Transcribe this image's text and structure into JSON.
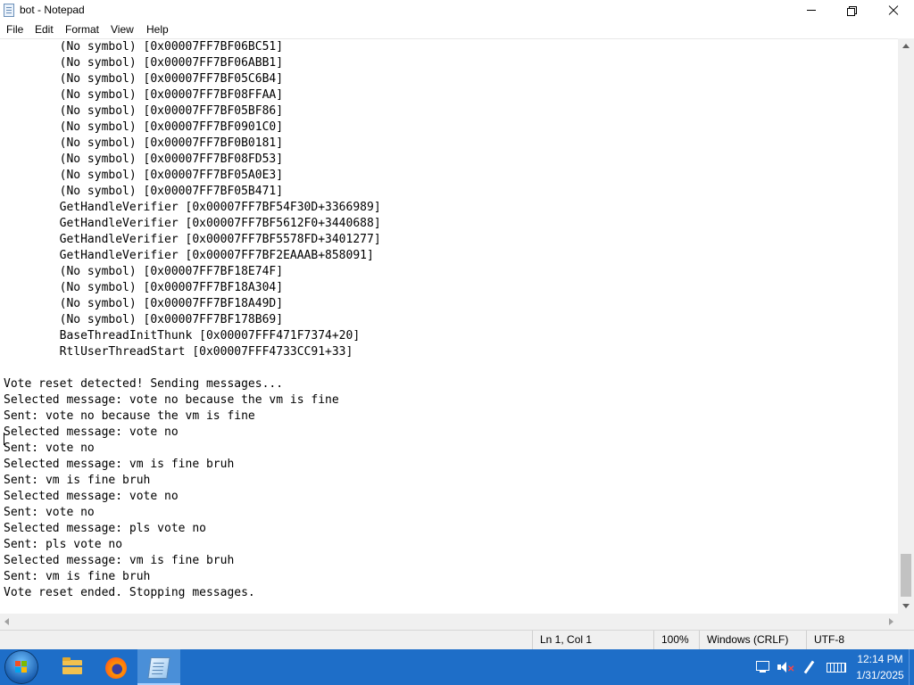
{
  "window": {
    "title": "bot - Notepad",
    "controls": {
      "minimize": "minimize",
      "maximize": "restore",
      "close": "close"
    }
  },
  "menu": {
    "items": [
      "File",
      "Edit",
      "Format",
      "View",
      "Help"
    ]
  },
  "editor": {
    "lines": [
      "        (No symbol) [0x00007FF7BF06BC51]",
      "        (No symbol) [0x00007FF7BF06ABB1]",
      "        (No symbol) [0x00007FF7BF05C6B4]",
      "        (No symbol) [0x00007FF7BF08FFAA]",
      "        (No symbol) [0x00007FF7BF05BF86]",
      "        (No symbol) [0x00007FF7BF0901C0]",
      "        (No symbol) [0x00007FF7BF0B0181]",
      "        (No symbol) [0x00007FF7BF08FD53]",
      "        (No symbol) [0x00007FF7BF05A0E3]",
      "        (No symbol) [0x00007FF7BF05B471]",
      "        GetHandleVerifier [0x00007FF7BF54F30D+3366989]",
      "        GetHandleVerifier [0x00007FF7BF5612F0+3440688]",
      "        GetHandleVerifier [0x00007FF7BF5578FD+3401277]",
      "        GetHandleVerifier [0x00007FF7BF2EAAAB+858091]",
      "        (No symbol) [0x00007FF7BF18E74F]",
      "        (No symbol) [0x00007FF7BF18A304]",
      "        (No symbol) [0x00007FF7BF18A49D]",
      "        (No symbol) [0x00007FF7BF178B69]",
      "        BaseThreadInitThunk [0x00007FFF471F7374+20]",
      "        RtlUserThreadStart [0x00007FFF4733CC91+33]",
      "",
      "Vote reset detected! Sending messages...",
      "Selected message: vote no because the vm is fine",
      "Sent: vote no because the vm is fine",
      "Selected message: vote no",
      "Sent: vote no",
      "Selected message: vm is fine bruh",
      "Sent: vm is fine bruh",
      "Selected message: vote no",
      "Sent: vote no",
      "Selected message: pls vote no",
      "Sent: pls vote no",
      "Selected message: vm is fine bruh",
      "Sent: vm is fine bruh",
      "Vote reset ended. Stopping messages."
    ]
  },
  "status": {
    "position": "Ln 1, Col 1",
    "zoom": "100%",
    "line_endings": "Windows (CRLF)",
    "encoding": "UTF-8"
  },
  "taskbar": {
    "apps": [
      "file-explorer",
      "firefox",
      "notepad"
    ],
    "active_app": "notepad",
    "tray_icons": [
      "network-icon",
      "volume-muted-icon",
      "pen-icon",
      "keyboard-icon"
    ],
    "clock_time": "12:14 PM",
    "clock_date": "1/31/2025",
    "color": "#1e6ec8"
  }
}
